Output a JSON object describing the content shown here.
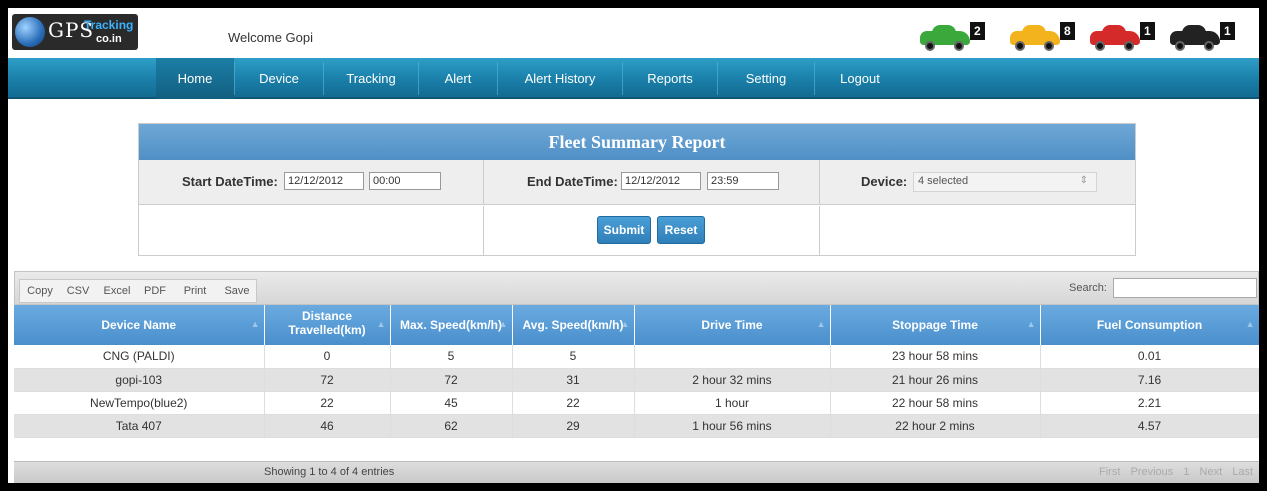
{
  "header": {
    "logo": {
      "gps": "GPS",
      "tracking": "Tracking",
      "domain": "co.in"
    },
    "welcome": "Welcome Gopi",
    "vehicle_counts": [
      {
        "color": "#3aa83a",
        "icon": "green-car-icon",
        "count": "2"
      },
      {
        "color": "#f2b31c",
        "icon": "yellow-car-icon",
        "count": "8"
      },
      {
        "color": "#d42a2a",
        "icon": "red-car-icon",
        "count": "1"
      },
      {
        "color": "#222222",
        "icon": "black-car-icon",
        "count": "1"
      }
    ]
  },
  "nav": {
    "items": [
      "Home",
      "Device",
      "Tracking",
      "Alert",
      "Alert History",
      "Reports",
      "Setting",
      "Logout"
    ],
    "active": "Home"
  },
  "report": {
    "title": "Fleet Summary Report",
    "start_label": "Start DateTime:",
    "start_date": "12/12/2012",
    "start_time": "00:00",
    "end_label": "End DateTime:",
    "end_date": "12/12/2012",
    "end_time": "23:59",
    "device_label": "Device:",
    "device_value": "4 selected",
    "submit": "Submit",
    "reset": "Reset"
  },
  "toolbar": {
    "buttons": [
      "Copy",
      "CSV",
      "Excel",
      "PDF",
      "Print",
      "Save"
    ],
    "search_label": "Search:"
  },
  "table": {
    "columns": [
      "Device Name",
      "Distance Travelled(km)",
      "Max. Speed(km/h)",
      "Avg. Speed(km/h)",
      "Drive Time",
      "Stoppage Time",
      "Fuel Consumption"
    ],
    "rows": [
      [
        "CNG (PALDI)",
        "0",
        "5",
        "5",
        "",
        "23 hour 58 mins",
        "0.01"
      ],
      [
        "gopi-103",
        "72",
        "72",
        "31",
        "2 hour 32 mins",
        "21 hour 26 mins",
        "7.16"
      ],
      [
        "NewTempo(blue2)",
        "22",
        "45",
        "22",
        "1 hour",
        "22 hour 58 mins",
        "2.21"
      ],
      [
        "Tata 407",
        "46",
        "62",
        "29",
        "1 hour 56 mins",
        "22 hour 2 mins",
        "4.57"
      ]
    ]
  },
  "footer": {
    "info": "Showing 1 to 4 of 4 entries",
    "pager": [
      "First",
      "Previous",
      "1",
      "Next",
      "Last"
    ]
  }
}
